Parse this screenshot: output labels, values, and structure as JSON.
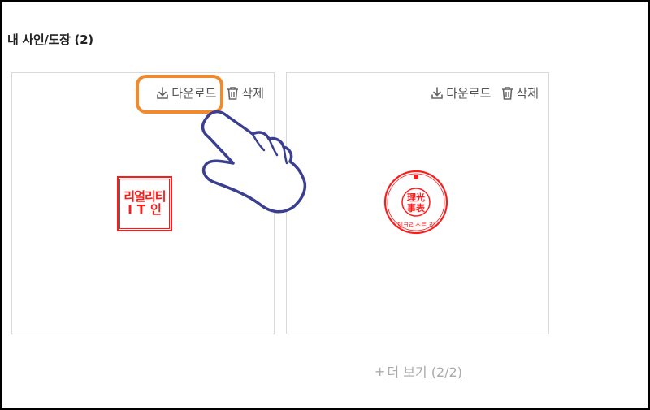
{
  "section": {
    "title": "내 사인/도장 (2)"
  },
  "cards": [
    {
      "download_label": "다운로드",
      "delete_label": "삭제",
      "stamp": {
        "line1": "리얼리티",
        "line2": "IT인"
      }
    },
    {
      "download_label": "다운로드",
      "delete_label": "삭제",
      "stamp": {
        "center_top": "理光",
        "center_bottom": "事表",
        "ring": "체크리스트 리"
      }
    }
  ],
  "more": {
    "plus": "+",
    "label": "더 보기 (2/2)"
  },
  "colors": {
    "stamp_red": "#ff1a1a",
    "highlight_orange": "#f08a2c",
    "text_gray": "#555555"
  }
}
